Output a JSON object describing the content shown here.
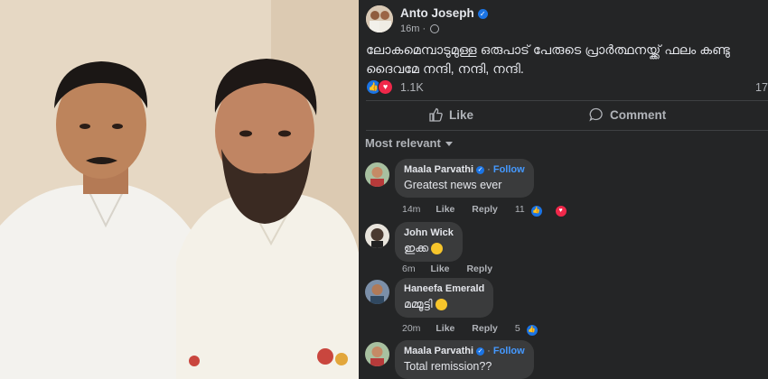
{
  "post": {
    "author": "Anto Joseph",
    "time": "16m · ",
    "text_line1": "ലോകമെമ്പാടുമുള്ള ഒരുപാട് പേരുടെ പ്രാർത്ഥനയ്ക്ക് ഫലം കണ്ടു",
    "text_line2": "ദൈവമേ നന്ദി, നന്ദി, നന്ദി.",
    "reaction_count": "1.1K",
    "comment_count": "17",
    "actions": {
      "like": "Like",
      "comment": "Comment"
    }
  },
  "sort_label": "Most relevant",
  "comments": [
    {
      "name": "Maala Parvathi",
      "follow": "Follow",
      "text": "Greatest news ever",
      "time": "14m",
      "like": "Like",
      "reply": "Reply",
      "reactions": "11"
    },
    {
      "name": "John Wick",
      "text": "ഇക്ക",
      "time": "6m",
      "like": "Like",
      "reply": "Reply"
    },
    {
      "name": "Haneefa Emerald",
      "text": "മമ്മൂട്ടി",
      "time": "20m",
      "like": "Like",
      "reply": "Reply",
      "reactions": "5"
    },
    {
      "name": "Maala Parvathi",
      "follow": "Follow",
      "text": "Total remission??"
    }
  ],
  "colors": {
    "background": "#242526",
    "bubble": "#3a3b3c",
    "accent": "#1b74e4",
    "love": "#f0284a",
    "follow": "#4599ff"
  },
  "icons": [
    "verified-badge-icon",
    "globe-icon",
    "like-reaction-icon",
    "love-reaction-icon",
    "thumbs-up-icon",
    "comment-bubble-icon",
    "caret-down-icon",
    "star-eyes-emoji-icon",
    "smile-emoji-icon"
  ]
}
